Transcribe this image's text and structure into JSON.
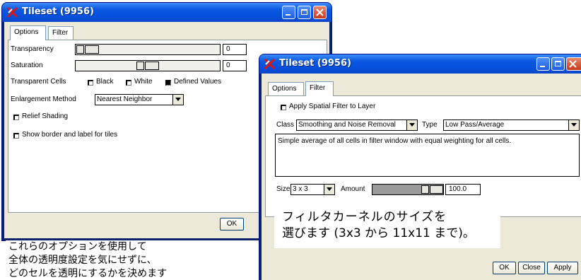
{
  "options_window": {
    "title": "Tileset (9956)",
    "tabs": [
      "Options",
      "Filter"
    ],
    "transparency_label": "Transparency",
    "transparency_value": "0",
    "saturation_label": "Saturation",
    "saturation_value": "0",
    "transparent_cells_label": "Transparent Cells",
    "cells_options": [
      {
        "label": "Black",
        "checked": false
      },
      {
        "label": "White",
        "checked": false
      },
      {
        "label": "Defined Values",
        "checked": true
      }
    ],
    "enlargement_label": "Enlargement Method",
    "enlargement_value": "Nearest Neighbor",
    "relief_shading_label": "Relief Shading",
    "show_border_label": "Show border and label for tiles",
    "ok_label": "OK"
  },
  "filter_window": {
    "title": "Tileset (9956)",
    "tabs": [
      "Options",
      "Filter"
    ],
    "apply_filter_label": "Apply Spatial Filter to Layer",
    "class_label": "Class",
    "class_value": "Smoothing and Noise Removal",
    "type_label": "Type",
    "type_value": "Low Pass/Average",
    "description": "Simple average of all cells in filter window with equal weighting for all cells.",
    "size_label": "Size",
    "size_value": "3 x 3",
    "amount_label": "Amount",
    "amount_value": "100.0",
    "buttons": {
      "ok": "OK",
      "close": "Close",
      "apply": "Apply"
    }
  },
  "annotations": {
    "filter_note_line1": "フィルタカーネルのサイズを",
    "filter_note_line2": "選びます (3x3 から 11x11 まで)。",
    "options_note_line1": "これらのオプションを使用して",
    "options_note_line2": "全体の透明度設定を気にせずに、",
    "options_note_line3": "どのセルを透明にするかを決めます"
  },
  "colors": {
    "title_bar": "#0a58e0",
    "client": "#ece9d8",
    "close_button": "#c8391b"
  }
}
